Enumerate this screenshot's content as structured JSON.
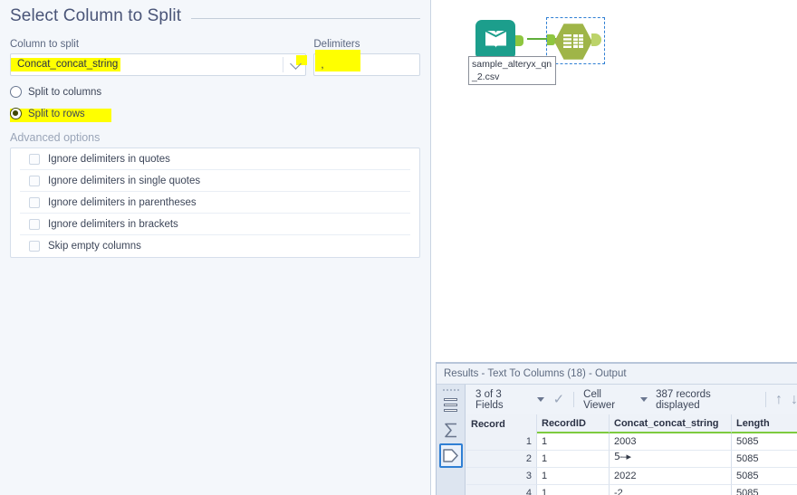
{
  "config_panel": {
    "section_title": "Select Column to Split",
    "column_label": "Column to split",
    "column_value": "Concat_concat_string",
    "delimiters_label": "Delimiters",
    "delimiters_value": ",",
    "split_mode": {
      "columns_label": "Split to columns",
      "rows_label": "Split to rows",
      "selected": "rows"
    },
    "advanced_title": "Advanced options",
    "advanced_options": [
      {
        "label": "Ignore delimiters in quotes",
        "checked": false
      },
      {
        "label": "Ignore delimiters in single quotes",
        "checked": false
      },
      {
        "label": "Ignore delimiters in parentheses",
        "checked": false
      },
      {
        "label": "Ignore delimiters in brackets",
        "checked": false
      },
      {
        "label": "Skip empty columns",
        "checked": false
      }
    ]
  },
  "canvas": {
    "input_node": {
      "icon": "open-book-icon",
      "label": "sample_alteryx_qn_2.csv",
      "color": "#1c9e8c"
    },
    "text_to_columns_node": {
      "icon": "table-grid-icon",
      "color": "#9fb548",
      "selected": true
    }
  },
  "results": {
    "title": "Results - Text To Columns (18) - Output",
    "toolbar": {
      "fields_label": "3 of 3 Fields",
      "viewer_label": "Cell Viewer",
      "records_label": "387 records displayed",
      "check_icon": "checkmark-icon",
      "up_icon": "arrow-up-icon",
      "down_icon": "arrow-down-icon"
    },
    "rail_icons": [
      {
        "name": "table-list-icon",
        "selected": false
      },
      {
        "name": "sigma-summary-icon",
        "selected": false
      },
      {
        "name": "output-anchor-icon",
        "selected": true
      }
    ],
    "table": {
      "columns": [
        "Record",
        "RecordID",
        "Concat_concat_string",
        "Length"
      ],
      "rows": [
        {
          "record": "1",
          "recordid": "1",
          "concat": "2003",
          "length": "5085"
        },
        {
          "record": "2",
          "recordid": "1",
          "concat": "5-–▸",
          "length": "5085"
        },
        {
          "record": "3",
          "recordid": "1",
          "concat": "2022",
          "length": "5085"
        },
        {
          "record": "4",
          "recordid": "1",
          "concat": "-2",
          "length": "5085"
        }
      ]
    }
  }
}
